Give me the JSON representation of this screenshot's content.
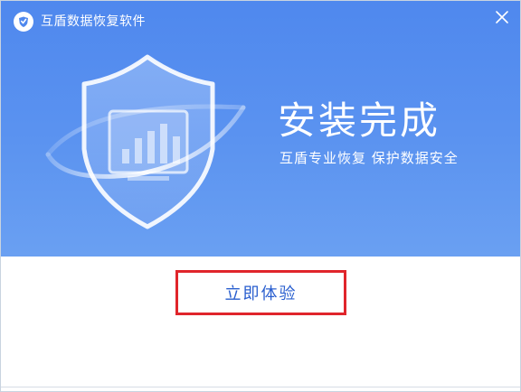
{
  "window": {
    "app_title": "互盾数据恢复软件",
    "close_icon": "close-icon",
    "logo_icon": "app-logo-icon"
  },
  "banner": {
    "headline": "安装完成",
    "tagline": "互盾专业恢复  保护数据安全",
    "illustration": "shield-chart-icon",
    "background_color": "#5b93f0"
  },
  "footer": {
    "cta_label": "立即体验",
    "cta_text_color": "#2a5fcf",
    "highlight_color": "#e0252b"
  }
}
